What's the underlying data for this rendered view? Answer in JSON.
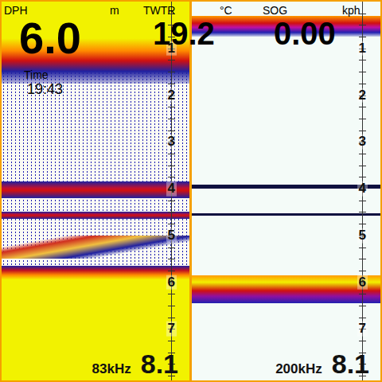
{
  "readouts": [
    {
      "label": "DPH",
      "value": "6.0",
      "unit": "m"
    },
    {
      "label": "TWTR",
      "value": "19.2",
      "unit": "°C"
    },
    {
      "label": "SOG",
      "value": "0.00",
      "unit": "kph"
    }
  ],
  "time": {
    "label": "Time",
    "value": "19:43"
  },
  "panels": [
    {
      "frequency": "83kHz",
      "range": "8.1",
      "scale": [
        "1",
        "2",
        "3",
        "4",
        "5",
        "6",
        "7"
      ],
      "echoes": [
        {
          "kind": "surface",
          "top": 0,
          "bottom": 1.75
        },
        {
          "kind": "line",
          "top": 3.85,
          "bottom": 4.2
        },
        {
          "kind": "line",
          "top": 4.5,
          "bottom": 4.65
        },
        {
          "kind": "arc",
          "top": 5.0,
          "bottom": 5.5
        },
        {
          "kind": "bottom",
          "top": 5.65,
          "bottom": 8.1
        }
      ]
    },
    {
      "frequency": "200kHz",
      "range": "8.1",
      "scale": [
        "1",
        "2",
        "3",
        "4",
        "5",
        "6",
        "7"
      ],
      "echoes": [
        {
          "kind": "surface",
          "top": 0.3,
          "bottom": 0.75
        },
        {
          "kind": "line",
          "top": 3.92,
          "bottom": 4.0
        },
        {
          "kind": "line",
          "top": 4.52,
          "bottom": 4.58
        },
        {
          "kind": "bottom",
          "top": 5.85,
          "bottom": 6.45
        }
      ]
    }
  ]
}
